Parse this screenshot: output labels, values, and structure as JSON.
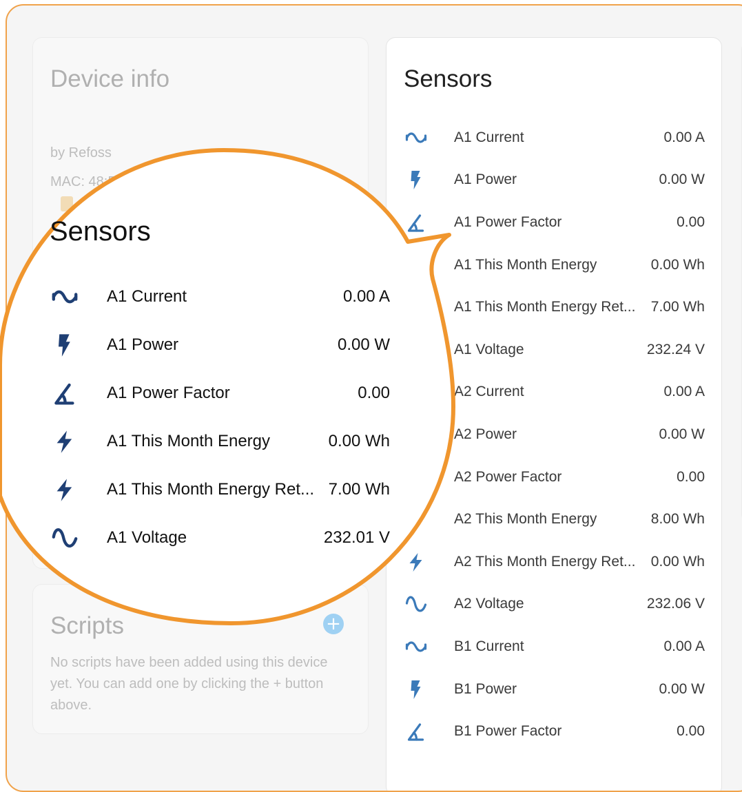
{
  "device_info": {
    "title": "Device info",
    "by": "by Refoss",
    "mac": "MAC: 48:E1:E9:E3:E2:06"
  },
  "scripts": {
    "title": "Scripts",
    "add_icon": "plus-icon",
    "description": "No scripts have been added using this device yet. You can add one by clicking the + button above."
  },
  "sensors": {
    "title": "Sensors",
    "items": [
      {
        "icon": "current-icon",
        "label": "A1 Current",
        "value": "0.00 A"
      },
      {
        "icon": "power-icon",
        "label": "A1 Power",
        "value": "0.00 W"
      },
      {
        "icon": "angle-icon",
        "label": "A1 Power Factor",
        "value": "0.00"
      },
      {
        "icon": "energy-icon",
        "label": "A1 This Month Energy",
        "value": "0.00 Wh"
      },
      {
        "icon": "energy-icon",
        "label": "A1 This Month Energy Ret...",
        "value": "7.00 Wh"
      },
      {
        "icon": "voltage-icon",
        "label": "A1 Voltage",
        "value": "232.24 V"
      },
      {
        "icon": "current-icon",
        "label": "A2 Current",
        "value": "0.00 A"
      },
      {
        "icon": "power-icon",
        "label": "A2 Power",
        "value": "0.00 W"
      },
      {
        "icon": "angle-icon",
        "label": "A2 Power Factor",
        "value": "0.00"
      },
      {
        "icon": "energy-icon",
        "label": "A2 This Month Energy",
        "value": "8.00 Wh"
      },
      {
        "icon": "energy-icon",
        "label": "A2 This Month Energy Ret...",
        "value": "0.00 Wh"
      },
      {
        "icon": "voltage-icon",
        "label": "A2 Voltage",
        "value": "232.06 V"
      },
      {
        "icon": "current-icon",
        "label": "B1 Current",
        "value": "0.00 A"
      },
      {
        "icon": "power-icon",
        "label": "B1 Power",
        "value": "0.00 W"
      },
      {
        "icon": "angle-icon",
        "label": "B1 Power Factor",
        "value": "0.00"
      }
    ]
  },
  "zoom": {
    "title": "Sensors",
    "items": [
      {
        "icon": "current-icon",
        "label": "A1 Current",
        "value": "0.00 A"
      },
      {
        "icon": "power-icon",
        "label": "A1 Power",
        "value": "0.00 W"
      },
      {
        "icon": "angle-icon",
        "label": "A1 Power Factor",
        "value": "0.00"
      },
      {
        "icon": "energy-icon",
        "label": "A1 This Month Energy",
        "value": "0.00 Wh"
      },
      {
        "icon": "energy-icon",
        "label": "A1 This Month Energy Ret...",
        "value": "7.00 Wh"
      },
      {
        "icon": "voltage-icon",
        "label": "A1 Voltage",
        "value": "232.01 V"
      }
    ]
  },
  "colors": {
    "highlight": "#f0962e",
    "icon": "#3b7ab9",
    "icon_zoom": "#1f3f74"
  }
}
